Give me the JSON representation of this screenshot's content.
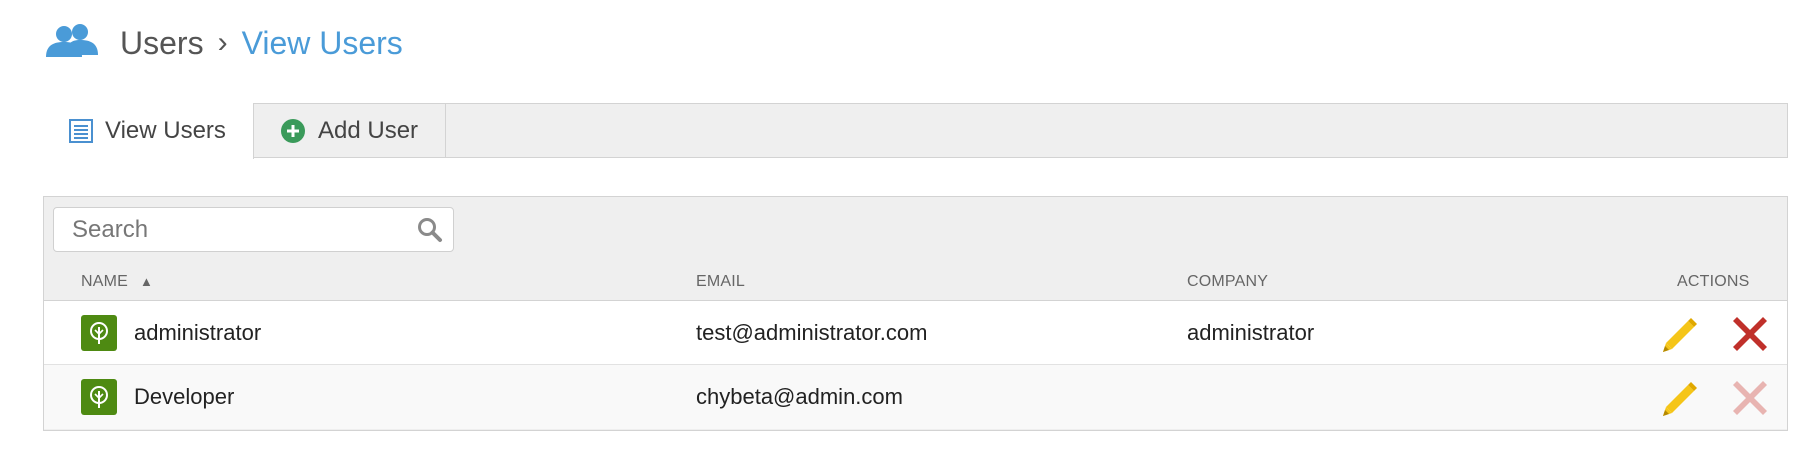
{
  "header": {
    "icon": "users-icon",
    "breadcrumb_root": "Users",
    "breadcrumb_separator": "›",
    "breadcrumb_current": "View Users"
  },
  "tabs": [
    {
      "label": "View Users",
      "icon": "list-icon",
      "active": true
    },
    {
      "label": "Add User",
      "icon": "plus-circle-icon",
      "active": false
    }
  ],
  "search": {
    "placeholder": "Search",
    "value": ""
  },
  "table": {
    "columns": {
      "name": "NAME",
      "email": "EMAIL",
      "company": "COMPANY",
      "actions": "ACTIONS"
    },
    "sort": {
      "column": "name",
      "indicator": "▲"
    },
    "rows": [
      {
        "name": "administrator",
        "email": "test@administrator.com",
        "company": "administrator",
        "delete_enabled": true
      },
      {
        "name": "Developer",
        "email": "chybeta@admin.com",
        "company": "",
        "delete_enabled": false
      }
    ]
  },
  "colors": {
    "accent": "#4a9bd8",
    "avatar": "#4e8a12",
    "edit": "#f5c518",
    "delete": "#c0302a",
    "delete_disabled": "#e8b4b1",
    "add_icon": "#3a9a5a"
  }
}
